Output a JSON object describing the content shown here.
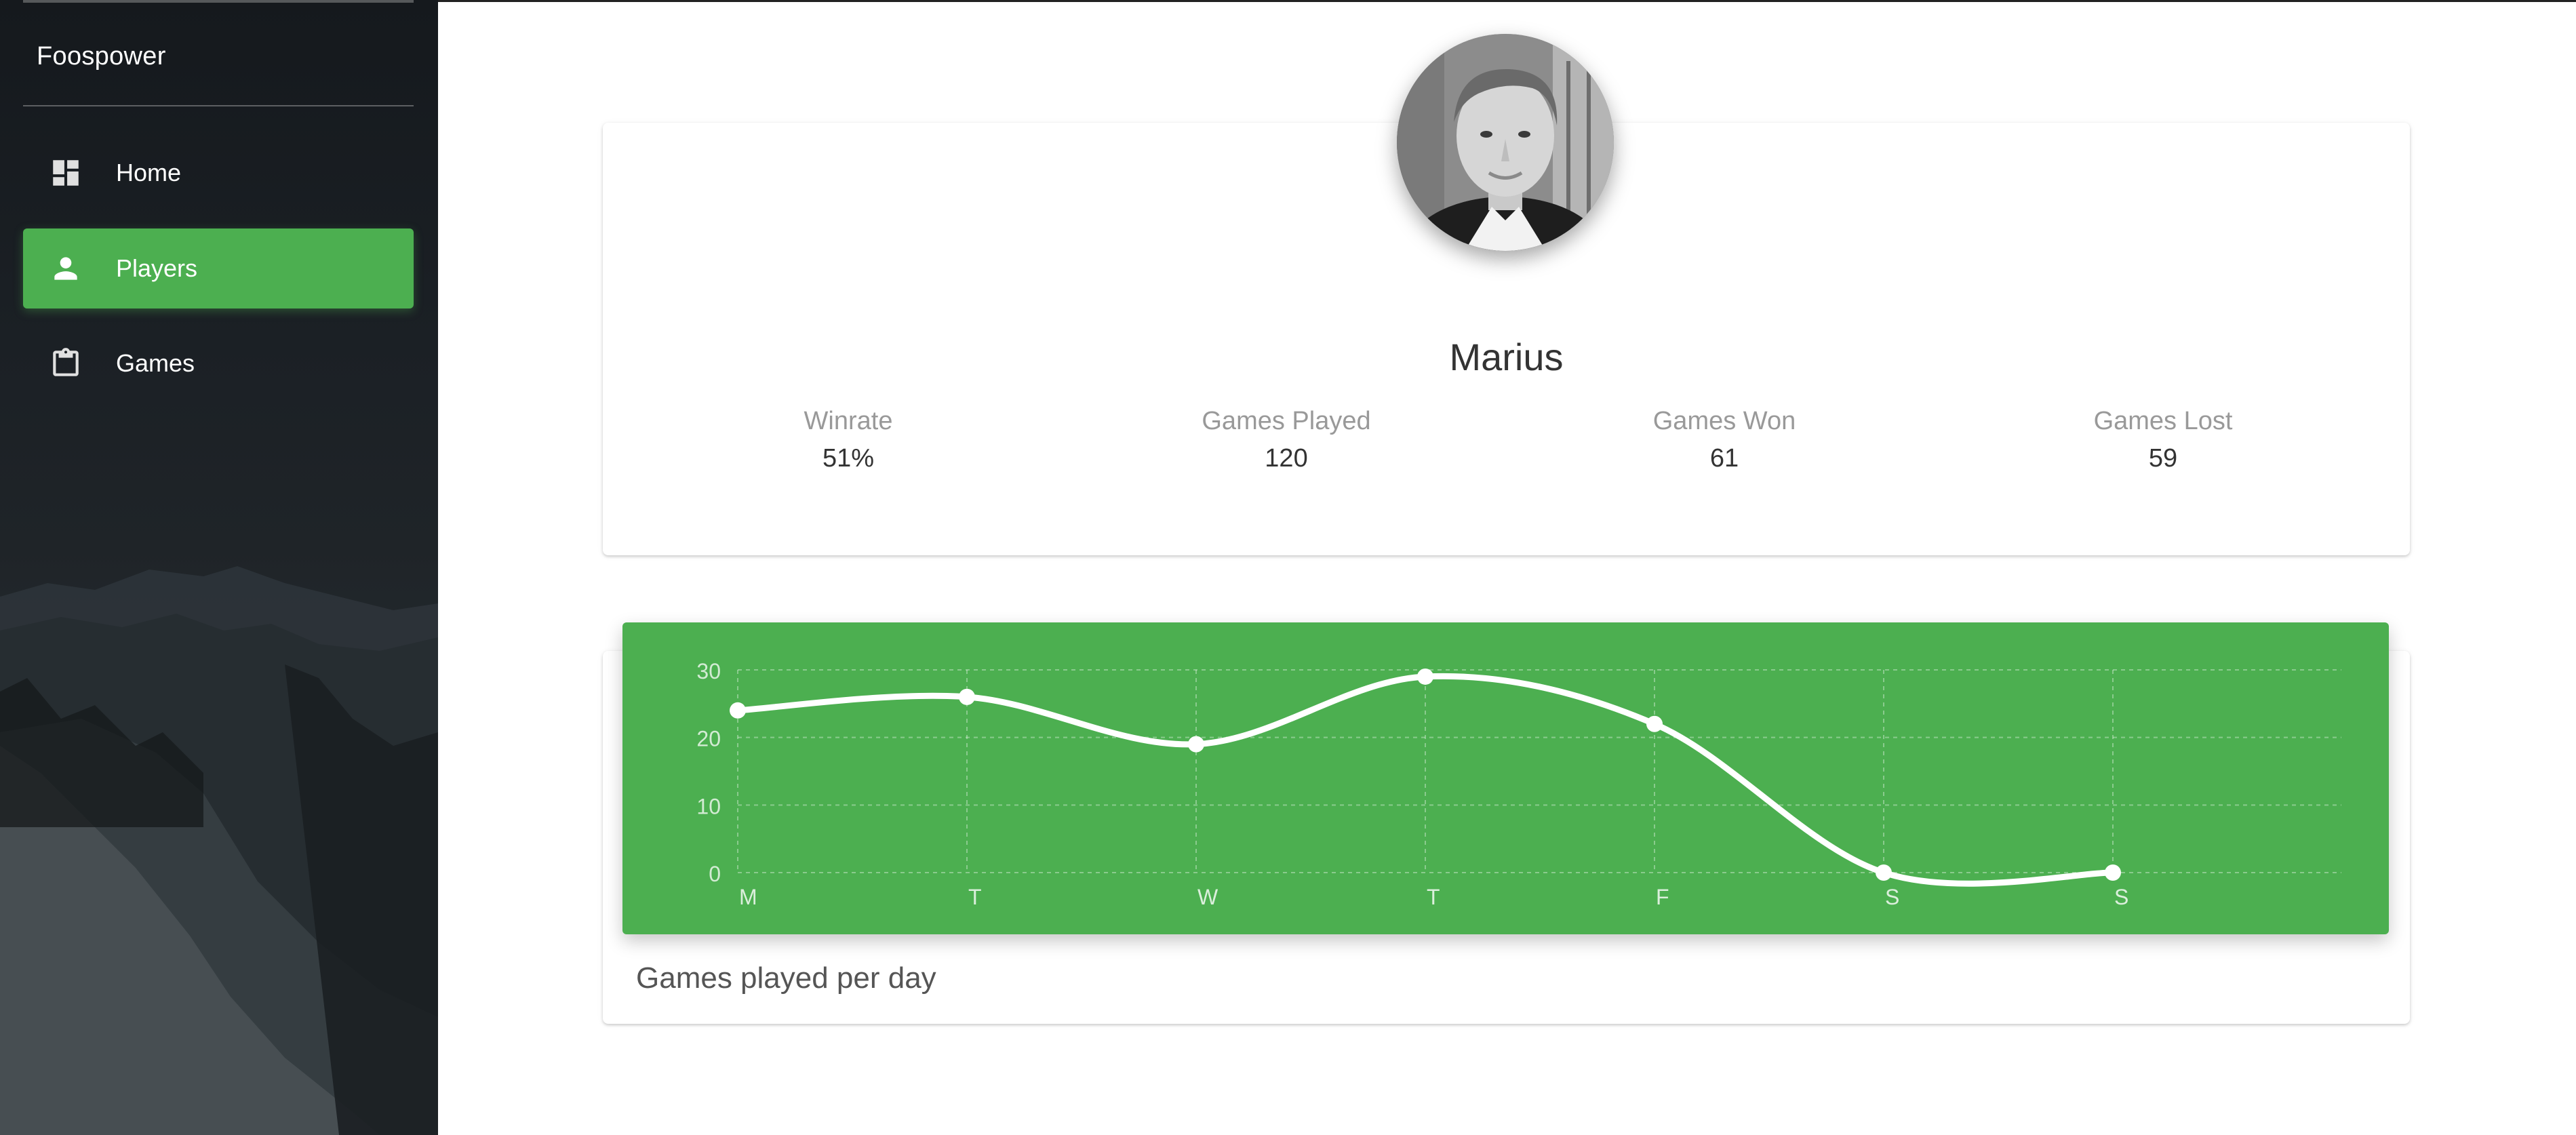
{
  "app": {
    "brand": "Foospower"
  },
  "sidebar": {
    "items": [
      {
        "label": "Home",
        "icon": "dashboard-icon",
        "active": false
      },
      {
        "label": "Players",
        "icon": "person-icon",
        "active": true
      },
      {
        "label": "Games",
        "icon": "clipboard-icon",
        "active": false
      }
    ]
  },
  "colors": {
    "accent": "#4caf50",
    "sidebar": "#1b2025"
  },
  "profile": {
    "name": "Marius",
    "avatar": "player-avatar-photo",
    "stats": [
      {
        "label": "Winrate",
        "value": "51%"
      },
      {
        "label": "Games Played",
        "value": "120"
      },
      {
        "label": "Games Won",
        "value": "61"
      },
      {
        "label": "Games Lost",
        "value": "59"
      }
    ]
  },
  "chart_card": {
    "caption": "Games played per day"
  },
  "chart_data": {
    "type": "line",
    "categories": [
      "M",
      "T",
      "W",
      "T",
      "F",
      "S",
      "S"
    ],
    "values": [
      24,
      26,
      19,
      29,
      22,
      0,
      0
    ],
    "ylim": [
      0,
      30
    ],
    "yticks": [
      "0",
      "10",
      "20",
      "30"
    ],
    "grid": true,
    "smooth": true,
    "line_color": "#ffffff"
  }
}
